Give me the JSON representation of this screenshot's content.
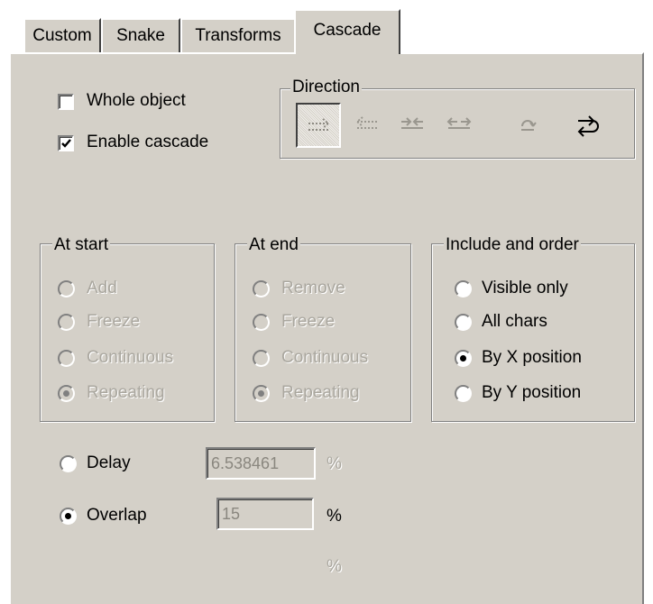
{
  "tabs": [
    {
      "label": "Custom"
    },
    {
      "label": "Snake"
    },
    {
      "label": "Transforms"
    },
    {
      "label": "Cascade"
    }
  ],
  "options": {
    "whole_object": {
      "label": "Whole object",
      "checked": false
    },
    "enable_cascade": {
      "label": "Enable cascade",
      "checked": true
    }
  },
  "direction": {
    "title": "Direction",
    "buttons": [
      {
        "icon": "arrow-right-icon",
        "pressed": true
      },
      {
        "icon": "arrow-left-icon",
        "pressed": false
      },
      {
        "icon": "arrows-inward-icon",
        "pressed": false
      },
      {
        "icon": "arrows-outward-icon",
        "pressed": false
      },
      {
        "icon": "rotate-icon",
        "pressed": false
      },
      {
        "icon": "loop-arrow-icon",
        "pressed": false
      }
    ]
  },
  "at_start": {
    "title": "At start",
    "items": [
      {
        "label": "Add",
        "selected": false
      },
      {
        "label": "Freeze",
        "selected": false
      },
      {
        "label": "Continuous",
        "selected": false
      },
      {
        "label": "Repeating",
        "selected": true
      }
    ]
  },
  "at_end": {
    "title": "At end",
    "items": [
      {
        "label": "Remove",
        "selected": false
      },
      {
        "label": "Freeze",
        "selected": false
      },
      {
        "label": "Continuous",
        "selected": false
      },
      {
        "label": "Repeating",
        "selected": true
      }
    ]
  },
  "include_order": {
    "title": "Include and order",
    "items": [
      {
        "label": "Visible only",
        "selected": false
      },
      {
        "label": "All chars",
        "selected": false
      },
      {
        "label": "By X position",
        "selected": true
      },
      {
        "label": "By Y position",
        "selected": false
      }
    ]
  },
  "timing": {
    "delay": {
      "label": "Delay",
      "value": "6.538461",
      "unit": "%",
      "selected": false
    },
    "overlap": {
      "label": "Overlap",
      "value": "15",
      "unit": "%",
      "selected": true
    },
    "extra_unit": "%"
  }
}
